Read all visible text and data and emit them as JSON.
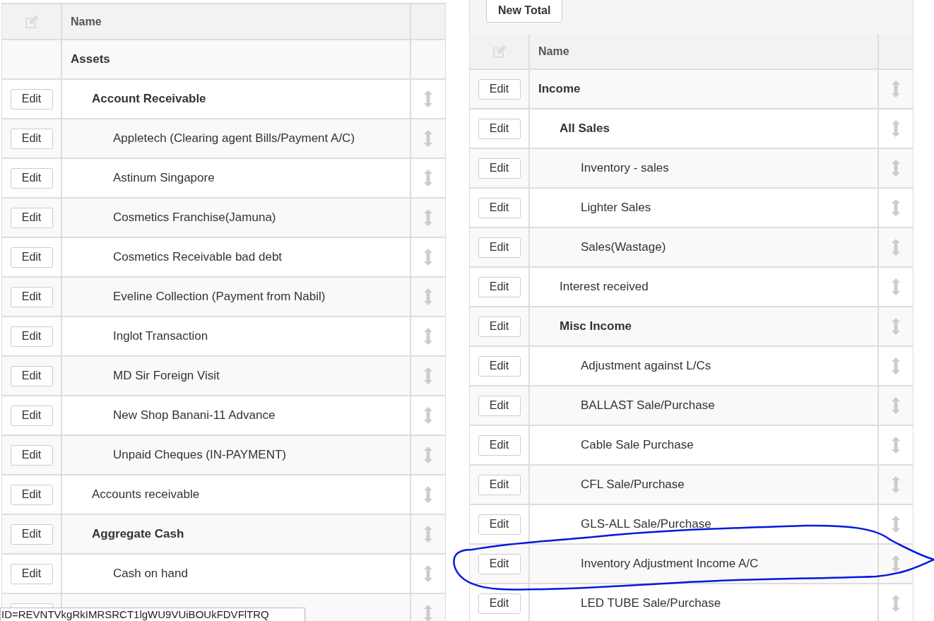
{
  "left_table": {
    "columns": [
      "Name"
    ],
    "rows": [
      {
        "name": "Assets",
        "bold": true,
        "children": [
          {
            "name": "Account Receivable",
            "bold": true,
            "edit_label": "Edit",
            "children": [
              {
                "name": "Appletech (Clearing agent Bills/Payment A/C)",
                "bold": false,
                "edit_label": "Edit"
              },
              {
                "name": "Astinum Singapore",
                "bold": false,
                "edit_label": "Edit"
              },
              {
                "name": "Cosmetics Franchise(Jamuna)",
                "bold": false,
                "edit_label": "Edit"
              },
              {
                "name": "Cosmetics Receivable bad debt",
                "bold": false,
                "edit_label": "Edit"
              },
              {
                "name": "Eveline Collection (Payment from Nabil)",
                "bold": false,
                "edit_label": "Edit"
              },
              {
                "name": "Inglot Transaction",
                "bold": false,
                "edit_label": "Edit"
              },
              {
                "name": "MD Sir Foreign Visit",
                "bold": false,
                "edit_label": "Edit"
              },
              {
                "name": "New Shop Banani-11 Advance",
                "bold": false,
                "edit_label": "Edit"
              },
              {
                "name": "Unpaid Cheques (IN-PAYMENT)",
                "bold": false,
                "edit_label": "Edit"
              }
            ]
          },
          {
            "name": "Accounts receivable",
            "bold": false,
            "edit_label": "Edit"
          },
          {
            "name": "Aggregate Cash",
            "bold": true,
            "edit_label": "Edit",
            "children": [
              {
                "name": "Cash on hand",
                "bold": false,
                "edit_label": "Edit"
              }
            ]
          }
        ]
      }
    ],
    "partial_last_row": true
  },
  "right_panel": {
    "new_total_button": "New Total"
  },
  "right_table": {
    "columns": [
      "Name"
    ],
    "rows": [
      {
        "name": "Income",
        "bold": true,
        "edit_label": "Edit",
        "children": [
          {
            "name": "All Sales",
            "bold": true,
            "edit_label": "Edit",
            "children": [
              {
                "name": "Inventory - sales",
                "bold": false,
                "edit_label": "Edit"
              },
              {
                "name": "Lighter Sales",
                "bold": false,
                "edit_label": "Edit"
              },
              {
                "name": "Sales(Wastage)",
                "bold": false,
                "edit_label": "Edit"
              }
            ]
          },
          {
            "name": "Interest received",
            "bold": false,
            "edit_label": "Edit"
          },
          {
            "name": "Misc Income",
            "bold": true,
            "edit_label": "Edit",
            "children": [
              {
                "name": "Adjustment against L/Cs",
                "bold": false,
                "edit_label": "Edit"
              },
              {
                "name": "BALLAST Sale/Purchase",
                "bold": false,
                "edit_label": "Edit"
              },
              {
                "name": "Cable Sale Purchase",
                "bold": false,
                "edit_label": "Edit"
              },
              {
                "name": "CFL Sale/Purchase",
                "bold": false,
                "edit_label": "Edit"
              },
              {
                "name": "GLS-ALL Sale/Purchase",
                "bold": false,
                "edit_label": "Edit"
              },
              {
                "name": "Inventory Adjustment Income A/C",
                "bold": false,
                "edit_label": "Edit"
              },
              {
                "name": "LED TUBE Sale/Purchase",
                "bold": false,
                "edit_label": "Edit"
              }
            ]
          }
        ]
      }
    ]
  },
  "status_tooltip": "ID=REVNTVkgRkIMRSRCT1lgWU9VUiBOUkFDVFlTRQ"
}
